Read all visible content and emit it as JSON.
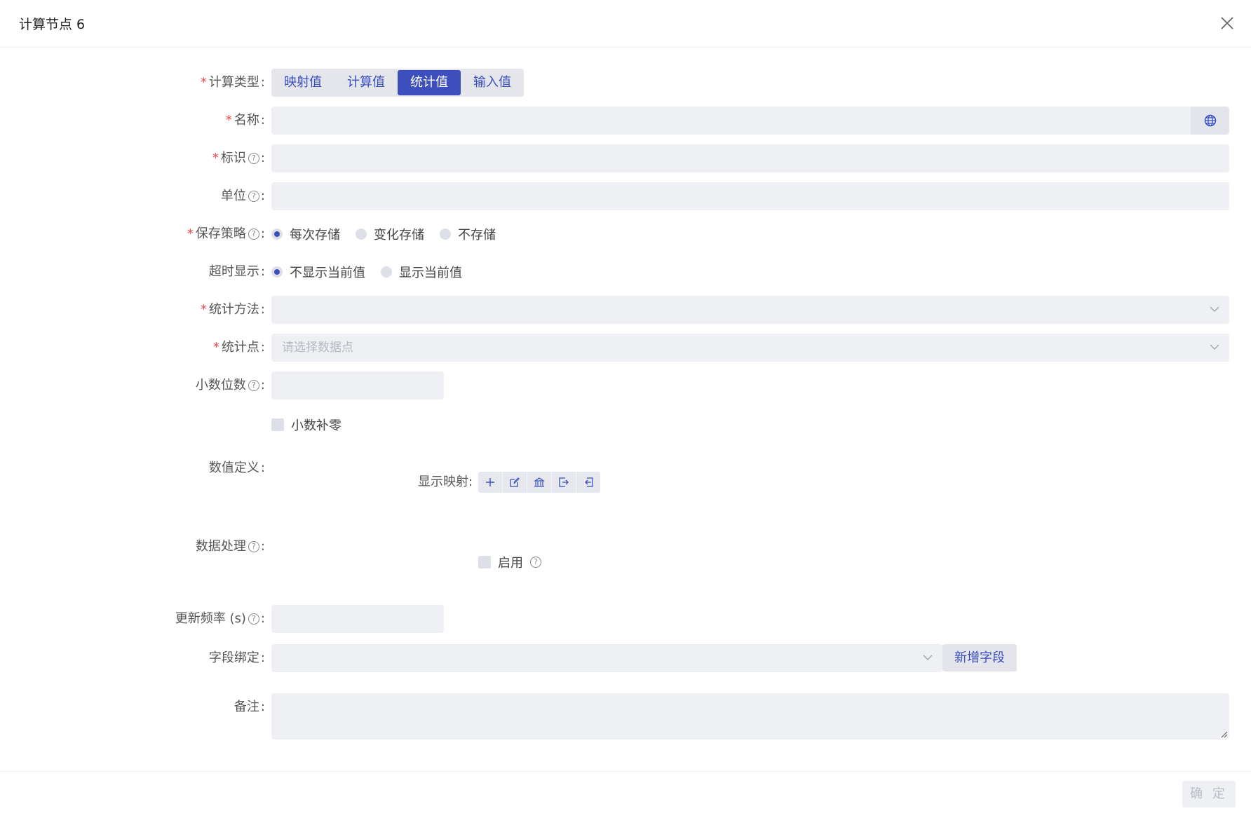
{
  "dialog": {
    "title": "计算节点 6"
  },
  "form": {
    "calc_type": {
      "label": "计算类型",
      "options": [
        "映射值",
        "计算值",
        "统计值",
        "输入值"
      ],
      "selected": "统计值"
    },
    "name": {
      "label": "名称",
      "value": ""
    },
    "identifier": {
      "label": "标识",
      "value": ""
    },
    "unit": {
      "label": "单位",
      "value": ""
    },
    "save_strategy": {
      "label": "保存策略",
      "options": [
        "每次存储",
        "变化存储",
        "不存储"
      ],
      "selected": "每次存储"
    },
    "timeout_display": {
      "label": "超时显示",
      "options": [
        "不显示当前值",
        "显示当前值"
      ],
      "selected": "不显示当前值"
    },
    "stat_method": {
      "label": "统计方法",
      "value": ""
    },
    "stat_point": {
      "label": "统计点",
      "placeholder": "请选择数据点"
    },
    "decimals": {
      "label": "小数位数",
      "value": ""
    },
    "pad_zero": {
      "label": "小数补零",
      "checked": false
    },
    "value_def": {
      "label": "数值定义",
      "display_map_label": "显示映射"
    },
    "data_process": {
      "label": "数据处理",
      "enable_label": "启用",
      "checked": false
    },
    "update_rate": {
      "label": "更新频率 (s)",
      "value": ""
    },
    "field_binding": {
      "label": "字段绑定",
      "value": "",
      "add_button": "新增字段"
    },
    "remark": {
      "label": "备注",
      "value": ""
    }
  },
  "footer": {
    "confirm": "确 定"
  },
  "colors": {
    "accent": "#3d4fbc",
    "required": "#f04848",
    "input_bg": "#eff0f3"
  },
  "icons": [
    "close-icon",
    "globe-icon",
    "help-icon",
    "chevron-down-icon",
    "plus-icon",
    "edit-icon",
    "bank-icon",
    "export-icon",
    "import-icon"
  ]
}
